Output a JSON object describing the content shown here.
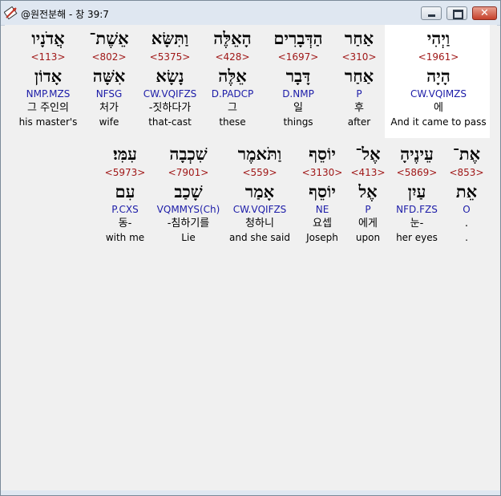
{
  "window": {
    "title": "@원전분해 - 창 39:7",
    "icon": "app-icon",
    "buttons": {
      "minimize": "minimize-icon",
      "maximize": "maximize-icon",
      "close": "✕"
    }
  },
  "words": [
    {
      "hebrew": "וַיְהִי",
      "strong": "<1961>",
      "lemma": "הָיָה",
      "morph": "CW.VQIMZS",
      "korean": "에",
      "english": "And it came to pass",
      "highlighted": true
    },
    {
      "hebrew": "אַחַר",
      "strong": "<310>",
      "lemma": "אַחַר",
      "morph": "P",
      "korean": "후",
      "english": "after"
    },
    {
      "hebrew": "הַדְּבָרִים",
      "strong": "<1697>",
      "lemma": "דָּבָר",
      "morph": "D.NMP",
      "korean": "일",
      "english": "things"
    },
    {
      "hebrew": "הָאֵלֶּה",
      "strong": "<428>",
      "lemma": "אֵלֶּה",
      "morph": "D.PADCP",
      "korean": "그",
      "english": "these"
    },
    {
      "hebrew": "וַתִּשָּׂא",
      "strong": "<5375>",
      "lemma": "נָשָׂא",
      "morph": "CW.VQIFZS",
      "korean": "-짓하다가",
      "english": "that-cast"
    },
    {
      "hebrew": "אֵשֶׁת־",
      "strong": "<802>",
      "lemma": "אִשָּׁה",
      "morph": "NFSG",
      "korean": "처가",
      "english": "wife"
    },
    {
      "hebrew": "אֲדֹנָיו",
      "strong": "<113>",
      "lemma": "אָדוֹן",
      "morph": "NMP.MZS",
      "korean": "그 주인의",
      "english": "his master's"
    },
    {
      "hebrew": "אֶת־",
      "strong": "<853>",
      "lemma": "אֵת",
      "morph": "O",
      "korean": ".",
      "english": "."
    },
    {
      "hebrew": "עֵינֶיהָ",
      "strong": "<5869>",
      "lemma": "עַיִן",
      "morph": "NFD.FZS",
      "korean": "눈-",
      "english": "her eyes"
    },
    {
      "hebrew": "אֶל־",
      "strong": "<413>",
      "lemma": "אֶל",
      "morph": "P",
      "korean": "에게",
      "english": "upon"
    },
    {
      "hebrew": "יוֹסֵף",
      "strong": "<3130>",
      "lemma": "יוֹסֵף",
      "morph": "NE",
      "korean": "요셉",
      "english": "Joseph"
    },
    {
      "hebrew": "וַתֹּאמֶר",
      "strong": "<559>",
      "lemma": "אָמַר",
      "morph": "CW.VQIFZS",
      "korean": "청하니",
      "english": "and she said"
    },
    {
      "hebrew": "שִׁכְבָה",
      "strong": "<7901>",
      "lemma": "שָׁכַב",
      "morph": "VQMMYS(Ch)",
      "korean": "-침하기를",
      "english": "Lie"
    },
    {
      "hebrew": "עִמִּי׃",
      "strong": "<5973>",
      "lemma": "עִם",
      "morph": "P.CXS",
      "korean": "동-",
      "english": "with me"
    }
  ]
}
